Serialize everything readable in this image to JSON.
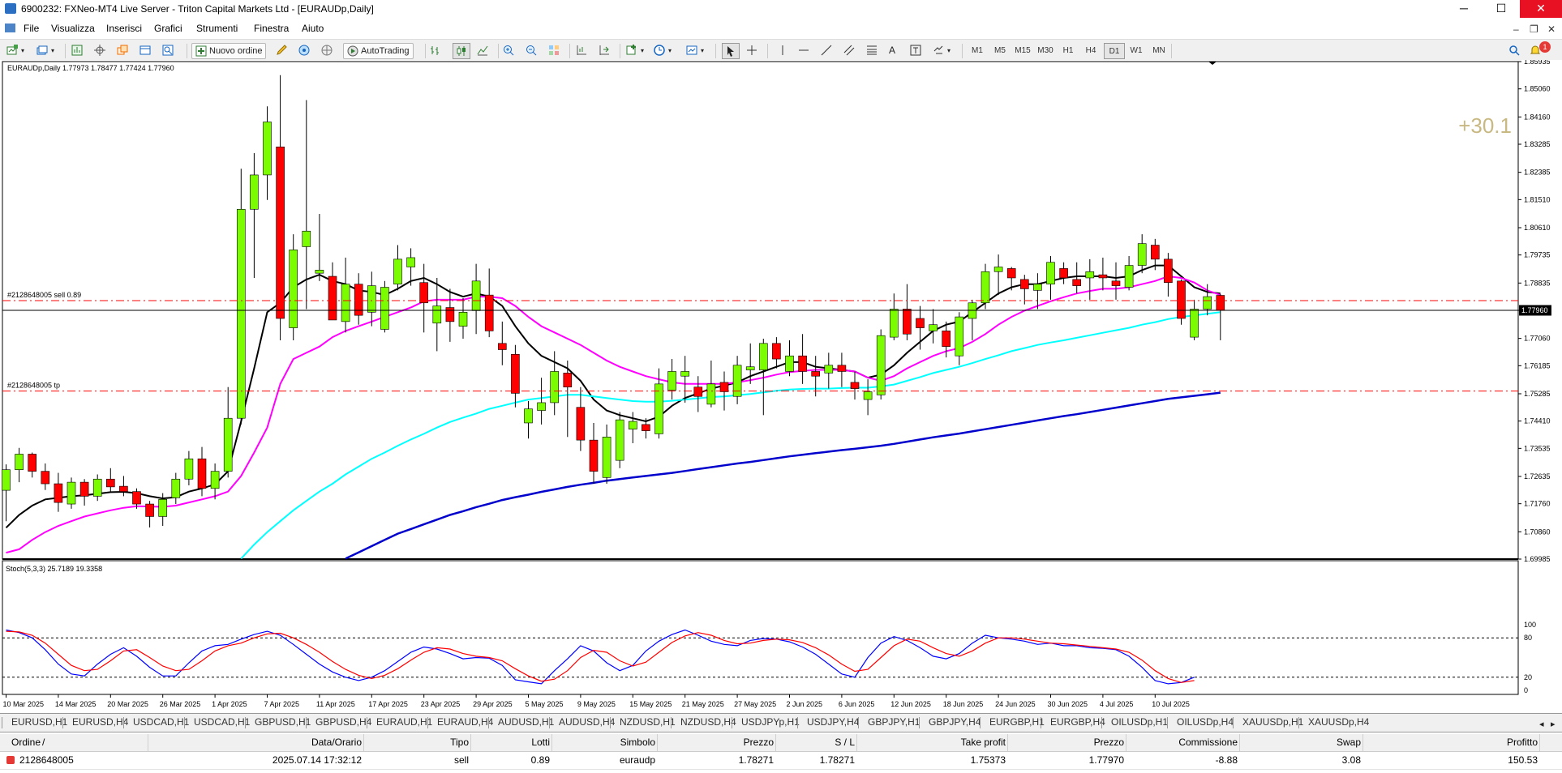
{
  "window": {
    "title": "6900232: FXNeo-MT4 Live Server - Triton Capital Markets Ltd - [EURAUDp,Daily]",
    "minimize_glyph": "─",
    "maximize_glyph": "☐",
    "close_glyph": "✕"
  },
  "menu": {
    "items": [
      "File",
      "Visualizza",
      "Inserisci",
      "Grafici",
      "Strumenti",
      "Finestra",
      "Aiuto"
    ],
    "notification_count": "1"
  },
  "toolbar": {
    "new_order_label": "Nuovo ordine",
    "autotrading_label": "AutoTrading",
    "text_tool_label": "A",
    "timeframes": [
      "M1",
      "M5",
      "M15",
      "M30",
      "H1",
      "H4",
      "D1",
      "W1",
      "MN"
    ],
    "active_timeframe": "D1"
  },
  "chart": {
    "header_text": "EURAUDp,Daily  1.77973 1.78477 1.77424 1.77960",
    "sell_label": "#2128648005 sell 0.89",
    "tp_label": "#2128648005 tp",
    "profit_overlay": "+30.1",
    "current_price_label": "1.77960",
    "price_axis_labels": [
      "1.85935",
      "1.85060",
      "1.84160",
      "1.83285",
      "1.82385",
      "1.81510",
      "1.80610",
      "1.79735",
      "1.78835",
      "1.77960",
      "1.77060",
      "1.76185",
      "1.75285",
      "1.74410",
      "1.73535",
      "1.72635",
      "1.71760",
      "1.70860",
      "1.69985"
    ],
    "stoch_label": "Stoch(5,3,3) 25.7189 19.3358",
    "stoch_axis_labels": [
      "100",
      "80",
      "20",
      "0"
    ],
    "date_labels": [
      "10 Mar 2025",
      "14 Mar 2025",
      "20 Mar 2025",
      "26 Mar 2025",
      "1 Apr 2025",
      "7 Apr 2025",
      "11 Apr 2025",
      "17 Apr 2025",
      "23 Apr 2025",
      "29 Apr 2025",
      "5 May 2025",
      "9 May 2025",
      "15 May 2025",
      "21 May 2025",
      "27 May 2025",
      "2 Jun 2025",
      "6 Jun 2025",
      "12 Jun 2025",
      "18 Jun 2025",
      "24 Jun 2025",
      "30 Jun 2025",
      "4 Jul 2025",
      "10 Jul 2025"
    ],
    "colors": {
      "bull": "#7cfc00",
      "bear": "#ff0000",
      "ma_fast": "#000000",
      "ma_mid": "#ff00ff",
      "ma_slow": "#00ffff",
      "ma_long": "#0000cd",
      "stoch_main": "#0000ff",
      "stoch_signal": "#ff0000",
      "order_line": "#ff0000",
      "profit": "#c8b882"
    }
  },
  "chart_data": {
    "type": "line",
    "title": "EURAUDp,Daily",
    "ylim": [
      1.69985,
      1.85935
    ],
    "candles": [
      [
        1.7219,
        1.7302,
        1.712,
        1.7285
      ],
      [
        1.7285,
        1.7355,
        1.7245,
        1.7335
      ],
      [
        1.7335,
        1.734,
        1.726,
        1.728
      ],
      [
        1.728,
        1.7305,
        1.722,
        1.724
      ],
      [
        1.724,
        1.7275,
        1.715,
        1.718
      ],
      [
        1.7175,
        1.726,
        1.716,
        1.7245
      ],
      [
        1.7245,
        1.7255,
        1.717,
        1.72
      ],
      [
        1.72,
        1.727,
        1.7185,
        1.7255
      ],
      [
        1.7255,
        1.729,
        1.7215,
        1.723
      ],
      [
        1.7232,
        1.7265,
        1.72,
        1.7215
      ],
      [
        1.7215,
        1.7225,
        1.716,
        1.7175
      ],
      [
        1.7175,
        1.7185,
        1.71,
        1.7135
      ],
      [
        1.7135,
        1.721,
        1.7105,
        1.719
      ],
      [
        1.7195,
        1.7275,
        1.7175,
        1.7255
      ],
      [
        1.7255,
        1.7345,
        1.7235,
        1.732
      ],
      [
        1.732,
        1.7358,
        1.72,
        1.7225
      ],
      [
        1.7225,
        1.7305,
        1.719,
        1.728
      ],
      [
        1.728,
        1.755,
        1.726,
        1.745
      ],
      [
        1.745,
        1.825,
        1.743,
        1.812
      ],
      [
        1.812,
        1.83,
        1.79,
        1.823
      ],
      [
        1.823,
        1.845,
        1.815,
        1.84
      ],
      [
        1.832,
        1.855,
        1.77,
        1.777
      ],
      [
        1.774,
        1.804,
        1.77,
        1.799
      ],
      [
        1.8,
        1.847,
        1.78,
        1.805
      ],
      [
        1.7915,
        1.8105,
        1.789,
        1.7925
      ],
      [
        1.7905,
        1.795,
        1.778,
        1.7765
      ],
      [
        1.776,
        1.7965,
        1.7725,
        1.788
      ],
      [
        1.788,
        1.7915,
        1.775,
        1.778
      ],
      [
        1.779,
        1.792,
        1.7745,
        1.7875
      ],
      [
        1.7735,
        1.789,
        1.7725,
        1.787
      ],
      [
        1.788,
        1.8005,
        1.786,
        1.796
      ],
      [
        1.7935,
        1.7995,
        1.7875,
        1.7965
      ],
      [
        1.7885,
        1.7945,
        1.7725,
        1.782
      ],
      [
        1.7755,
        1.79,
        1.7665,
        1.781
      ],
      [
        1.7805,
        1.7865,
        1.7695,
        1.776
      ],
      [
        1.7745,
        1.7835,
        1.7705,
        1.779
      ],
      [
        1.7795,
        1.7945,
        1.772,
        1.789
      ],
      [
        1.7845,
        1.793,
        1.771,
        1.773
      ],
      [
        1.769,
        1.776,
        1.762,
        1.767
      ],
      [
        1.7655,
        1.7685,
        1.7485,
        1.753
      ],
      [
        1.7435,
        1.7505,
        1.7385,
        1.748
      ],
      [
        1.7475,
        1.758,
        1.743,
        1.75
      ],
      [
        1.75,
        1.7665,
        1.746,
        1.76
      ],
      [
        1.7595,
        1.7635,
        1.739,
        1.755
      ],
      [
        1.7485,
        1.755,
        1.7345,
        1.738
      ],
      [
        1.738,
        1.7435,
        1.724,
        1.728
      ],
      [
        1.726,
        1.743,
        1.724,
        1.739
      ],
      [
        1.7315,
        1.747,
        1.729,
        1.7445
      ],
      [
        1.7415,
        1.747,
        1.737,
        1.744
      ],
      [
        1.743,
        1.745,
        1.7385,
        1.741
      ],
      [
        1.74,
        1.761,
        1.7385,
        1.756
      ],
      [
        1.754,
        1.764,
        1.751,
        1.76
      ],
      [
        1.7585,
        1.765,
        1.75,
        1.76
      ],
      [
        1.755,
        1.7585,
        1.747,
        1.752
      ],
      [
        1.7495,
        1.7635,
        1.7485,
        1.756
      ],
      [
        1.7565,
        1.76,
        1.7475,
        1.7535
      ],
      [
        1.752,
        1.765,
        1.7495,
        1.762
      ],
      [
        1.7605,
        1.769,
        1.756,
        1.7615
      ],
      [
        1.7605,
        1.7705,
        1.746,
        1.769
      ],
      [
        1.769,
        1.771,
        1.761,
        1.764
      ],
      [
        1.76,
        1.77,
        1.7585,
        1.765
      ],
      [
        1.765,
        1.772,
        1.756,
        1.76
      ],
      [
        1.76,
        1.765,
        1.752,
        1.7585
      ],
      [
        1.7595,
        1.766,
        1.7545,
        1.762
      ],
      [
        1.762,
        1.766,
        1.755,
        1.76
      ],
      [
        1.7565,
        1.76,
        1.751,
        1.7545
      ],
      [
        1.751,
        1.7575,
        1.746,
        1.7535
      ],
      [
        1.7525,
        1.7735,
        1.751,
        1.7715
      ],
      [
        1.771,
        1.785,
        1.77,
        1.78
      ],
      [
        1.78,
        1.788,
        1.77,
        1.772
      ],
      [
        1.777,
        1.781,
        1.767,
        1.774
      ],
      [
        1.773,
        1.78,
        1.769,
        1.775
      ],
      [
        1.773,
        1.776,
        1.7645,
        1.768
      ],
      [
        1.765,
        1.779,
        1.762,
        1.7775
      ],
      [
        1.777,
        1.783,
        1.77,
        1.782
      ],
      [
        1.782,
        1.7945,
        1.78,
        1.792
      ],
      [
        1.792,
        1.7975,
        1.7845,
        1.7935
      ],
      [
        1.793,
        1.7935,
        1.786,
        1.79
      ],
      [
        1.7895,
        1.791,
        1.7815,
        1.7865
      ],
      [
        1.786,
        1.7915,
        1.78,
        1.788
      ],
      [
        1.788,
        1.797,
        1.783,
        1.795
      ],
      [
        1.793,
        1.795,
        1.788,
        1.79
      ],
      [
        1.7895,
        1.795,
        1.785,
        1.7875
      ],
      [
        1.79,
        1.796,
        1.783,
        1.792
      ],
      [
        1.791,
        1.7965,
        1.786,
        1.79
      ],
      [
        1.789,
        1.795,
        1.783,
        1.7875
      ],
      [
        1.787,
        1.797,
        1.786,
        1.794
      ],
      [
        1.794,
        1.804,
        1.7915,
        1.801
      ],
      [
        1.8005,
        1.8025,
        1.7925,
        1.796
      ],
      [
        1.796,
        1.798,
        1.784,
        1.7885
      ],
      [
        1.789,
        1.7895,
        1.775,
        1.777
      ],
      [
        1.771,
        1.783,
        1.77,
        1.78
      ],
      [
        1.78,
        1.788,
        1.778,
        1.784
      ],
      [
        1.7844,
        1.7848,
        1.77,
        1.7796
      ]
    ],
    "series": [
      {
        "name": "",
        "color": "#000000",
        "values": [
          1.7099,
          1.714,
          1.717,
          1.719,
          1.7195,
          1.72,
          1.7203,
          1.7208,
          1.7213,
          1.7214,
          1.721,
          1.72,
          1.7193,
          1.7197,
          1.7215,
          1.7225,
          1.7238,
          1.728,
          1.744,
          1.761,
          1.779,
          1.782,
          1.787,
          1.7895,
          1.791,
          1.789,
          1.788,
          1.786,
          1.7855,
          1.7845,
          1.7865,
          1.789,
          1.79,
          1.788,
          1.7855,
          1.784,
          1.785,
          1.784,
          1.781,
          1.7745,
          1.769,
          1.765,
          1.763,
          1.761,
          1.757,
          1.751,
          1.7475,
          1.746,
          1.745,
          1.744,
          1.7455,
          1.749,
          1.7515,
          1.753,
          1.7545,
          1.7555,
          1.7565,
          1.7585,
          1.76,
          1.7615,
          1.763,
          1.763,
          1.7615,
          1.761,
          1.7605,
          1.76,
          1.758,
          1.759,
          1.762,
          1.766,
          1.7695,
          1.773,
          1.775,
          1.776,
          1.779,
          1.782,
          1.785,
          1.787,
          1.788,
          1.788,
          1.789,
          1.79,
          1.7905,
          1.7905,
          1.7905,
          1.79,
          1.7905,
          1.7925,
          1.794,
          1.794,
          1.7905,
          1.787,
          1.7855,
          1.785
        ]
      },
      {
        "name": "",
        "color": "#ff00ff",
        "values": [
          1.7019,
          1.703,
          1.706,
          1.7085,
          1.7105,
          1.712,
          1.7135,
          1.7145,
          1.7155,
          1.7163,
          1.7168,
          1.7167,
          1.7166,
          1.717,
          1.718,
          1.719,
          1.72,
          1.7215,
          1.7265,
          1.734,
          1.742,
          1.756,
          1.764,
          1.766,
          1.768,
          1.771,
          1.773,
          1.7745,
          1.776,
          1.7775,
          1.779,
          1.7805,
          1.7825,
          1.783,
          1.783,
          1.783,
          1.784,
          1.784,
          1.7835,
          1.781,
          1.7775,
          1.7745,
          1.7725,
          1.7705,
          1.7685,
          1.766,
          1.7635,
          1.7615,
          1.76,
          1.7585,
          1.7575,
          1.7565,
          1.756,
          1.756,
          1.756,
          1.756,
          1.7565,
          1.7572,
          1.758,
          1.759,
          1.7598,
          1.7602,
          1.7605,
          1.7605,
          1.7605,
          1.76,
          1.758,
          1.757,
          1.7585,
          1.761,
          1.763,
          1.765,
          1.7665,
          1.7675,
          1.7695,
          1.772,
          1.775,
          1.7775,
          1.7795,
          1.781,
          1.7825,
          1.7838,
          1.785,
          1.7858,
          1.7865,
          1.7865,
          1.787,
          1.788,
          1.789,
          1.7905,
          1.79,
          1.7885,
          1.786,
          1.7845
        ]
      },
      {
        "name": "",
        "color": "#00ffff",
        "values": [
          null,
          null,
          null,
          null,
          null,
          null,
          null,
          null,
          null,
          null,
          null,
          null,
          null,
          null,
          null,
          null,
          null,
          null,
          1.7,
          1.7045,
          1.7085,
          1.712,
          1.7155,
          1.7185,
          1.7215,
          1.724,
          1.727,
          1.7295,
          1.732,
          1.734,
          1.7362,
          1.7382,
          1.74,
          1.742,
          1.7438,
          1.7452,
          1.7465,
          1.748,
          1.749,
          1.75,
          1.751,
          1.7515,
          1.752,
          1.7525,
          1.7525,
          1.752,
          1.7515,
          1.751,
          1.7505,
          1.7503,
          1.7503,
          1.7506,
          1.751,
          1.7514,
          1.7518,
          1.752,
          1.7524,
          1.7528,
          1.7533,
          1.7538,
          1.7542,
          1.7544,
          1.7545,
          1.7545,
          1.7547,
          1.7548,
          1.7548,
          1.7552,
          1.7558,
          1.757,
          1.7582,
          1.7595,
          1.7605,
          1.7615,
          1.7627,
          1.764,
          1.7652,
          1.7665,
          1.7675,
          1.7685,
          1.7693,
          1.77,
          1.7708,
          1.7716,
          1.7724,
          1.7732,
          1.774,
          1.775,
          1.7758,
          1.7768,
          1.7775,
          1.778,
          1.7785,
          1.779
        ]
      },
      {
        "name": "",
        "color": "#0000cd",
        "values": [
          null,
          null,
          null,
          null,
          null,
          null,
          null,
          null,
          null,
          null,
          null,
          null,
          null,
          null,
          null,
          null,
          null,
          null,
          null,
          null,
          null,
          null,
          null,
          null,
          null,
          null,
          1.7,
          1.702,
          1.704,
          1.706,
          1.708,
          1.7095,
          1.711,
          1.7125,
          1.714,
          1.7152,
          1.7165,
          1.7176,
          1.7188,
          1.7197,
          1.7205,
          1.7214,
          1.7222,
          1.723,
          1.7237,
          1.7243,
          1.725,
          1.7255,
          1.726,
          1.7265,
          1.727,
          1.7275,
          1.7281,
          1.7287,
          1.7293,
          1.7299,
          1.7305,
          1.731,
          1.7316,
          1.7322,
          1.7328,
          1.7333,
          1.7338,
          1.7343,
          1.7348,
          1.7352,
          1.7357,
          1.7362,
          1.7368,
          1.7375,
          1.7382,
          1.7389,
          1.7395,
          1.7401,
          1.7408,
          1.7415,
          1.7422,
          1.7429,
          1.7436,
          1.7443,
          1.745,
          1.7457,
          1.7463,
          1.747,
          1.7477,
          1.7484,
          1.7491,
          1.7498,
          1.7505,
          1.7512,
          1.7517,
          1.7522,
          1.7527,
          1.7532
        ]
      }
    ],
    "stochastic": {
      "main": [
        92,
        88,
        80,
        62,
        40,
        25,
        22,
        40,
        55,
        65,
        52,
        35,
        22,
        22,
        42,
        60,
        68,
        70,
        78,
        85,
        90,
        84,
        70,
        55,
        40,
        28,
        20,
        15,
        20,
        30,
        44,
        58,
        66,
        63,
        56,
        48,
        50,
        49,
        38,
        16,
        13,
        10,
        30,
        48,
        68,
        60,
        42,
        30,
        38,
        60,
        75,
        85,
        92,
        84,
        75,
        70,
        68,
        76,
        79,
        78,
        74,
        66,
        55,
        40,
        25,
        20,
        50,
        72,
        82,
        76,
        65,
        52,
        48,
        56,
        72,
        84,
        80,
        78,
        75,
        70,
        72,
        68,
        68,
        65,
        64,
        62,
        52,
        35,
        15,
        10,
        12,
        20
      ],
      "signal": [
        90,
        89,
        84,
        72,
        55,
        38,
        30,
        32,
        45,
        60,
        62,
        50,
        37,
        30,
        32,
        45,
        60,
        68,
        72,
        80,
        86,
        87,
        80,
        70,
        58,
        44,
        32,
        23,
        18,
        23,
        33,
        46,
        58,
        65,
        63,
        56,
        52,
        50,
        45,
        33,
        22,
        14,
        17,
        30,
        50,
        61,
        58,
        45,
        37,
        43,
        58,
        73,
        83,
        88,
        84,
        76,
        71,
        72,
        76,
        78,
        77,
        73,
        65,
        54,
        40,
        29,
        32,
        50,
        68,
        78,
        75,
        65,
        56,
        52,
        60,
        72,
        80,
        80,
        78,
        75,
        72,
        71,
        69,
        67,
        65,
        63,
        58,
        46,
        30,
        18,
        12,
        15
      ]
    }
  },
  "tabs": [
    "EURUSD,H1",
    "EURUSD,H4",
    "USDCAD,H1",
    "USDCAD,H1",
    "GBPUSD,H1",
    "GBPUSD,H4",
    "EURAUD,H1",
    "EURAUD,H4",
    "AUDUSD,H1",
    "AUDUSD,H4",
    "NZDUSD,H1",
    "NZDUSD,H4",
    "USDJPYp,H1",
    "USDJPY,H4",
    "GBPJPY,H1",
    "GBPJPY,H4",
    "EURGBP,H1",
    "EURGBP,H4",
    "OILUSDp,H1",
    "OILUSDp,H4",
    "XAUUSDp,H1",
    "XAUUSDp,H4"
  ],
  "terminal": {
    "headers": [
      "Ordine",
      "Data/Orario",
      "Tipo",
      "Lotti",
      "Simbolo",
      "Prezzo",
      "S / L",
      "Take profit",
      "Prezzo",
      "Commissione",
      "Swap",
      "Profitto"
    ],
    "sort_indicator": "/",
    "rows": [
      [
        "2128648005",
        "2025.07.14 17:32:12",
        "sell",
        "0.89",
        "euraudp",
        "1.78271",
        "1.78271",
        "1.75373",
        "1.77970",
        "-8.88",
        "3.08",
        "150.53"
      ]
    ]
  }
}
